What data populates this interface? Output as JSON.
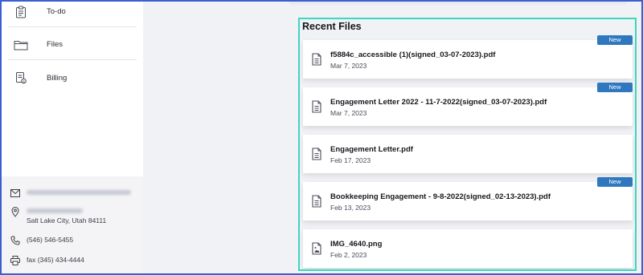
{
  "sidebar": {
    "items": [
      {
        "label": "To-do",
        "icon": "clipboard-icon"
      },
      {
        "label": "Files",
        "icon": "folder-icon"
      },
      {
        "label": "Billing",
        "icon": "billing-icon"
      }
    ]
  },
  "contact": {
    "address_line2": "Salt Lake City, Utah 84111",
    "phone": "(546) 546-5455",
    "fax": "fax (345) 434-4444"
  },
  "recent_files": {
    "title": "Recent Files",
    "new_badge": "New",
    "files": [
      {
        "name": "f5884c_accessible (1)(signed_03-07-2023).pdf",
        "date": "Mar 7, 2023",
        "is_new": true,
        "icon": "document-icon"
      },
      {
        "name": "Engagement Letter 2022 - 11-7-2022(signed_03-07-2023).pdf",
        "date": "Mar 7, 2023",
        "is_new": true,
        "icon": "document-icon"
      },
      {
        "name": "Engagement Letter.pdf",
        "date": "Feb 17, 2023",
        "is_new": false,
        "icon": "document-icon"
      },
      {
        "name": "Bookkeeping Engagement - 9-8-2022(signed_02-13-2023).pdf",
        "date": "Feb 13, 2023",
        "is_new": true,
        "icon": "document-icon"
      },
      {
        "name": "IMG_4640.png",
        "date": "Feb 2, 2023",
        "is_new": false,
        "icon": "image-file-icon"
      }
    ]
  },
  "colors": {
    "accent_outline": "#3dd6bf",
    "badge": "#2f78bf",
    "frame": "#3a5fd0"
  }
}
